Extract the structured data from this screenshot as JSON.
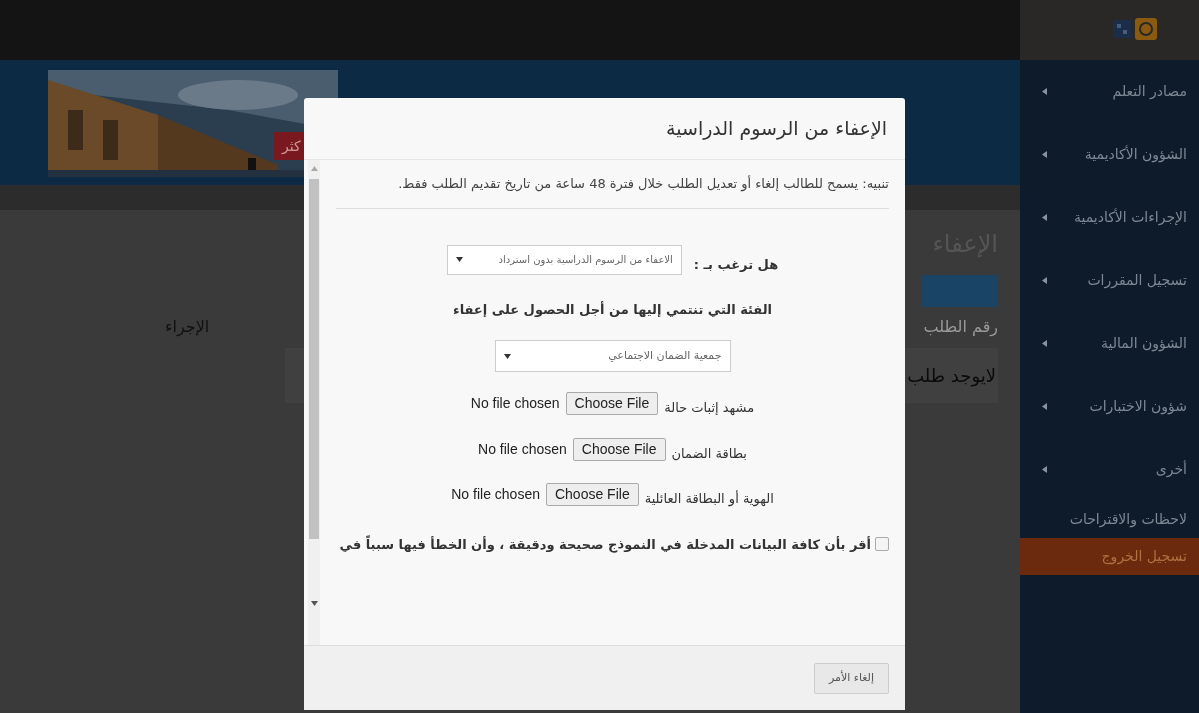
{
  "banner": {
    "badge": "كثر"
  },
  "page": {
    "heading": "الإعفاء",
    "request_number_label": "رقم الطلب",
    "action_label": "الإجراء",
    "empty_message": "لايوجد طلب"
  },
  "sidebar": {
    "items": [
      {
        "label": "مصادر التعلم",
        "kind": "submenu",
        "selected": false
      },
      {
        "label": "الشؤون الأكاديمية",
        "kind": "submenu",
        "selected": false
      },
      {
        "label": "الإجراءات الأكاديمية",
        "kind": "submenu",
        "selected": false
      },
      {
        "label": "تسجيل المقررات",
        "kind": "submenu",
        "selected": false
      },
      {
        "label": "الشؤون المالية",
        "kind": "submenu",
        "selected": false
      },
      {
        "label": "شؤون الاختبارات",
        "kind": "submenu",
        "selected": false
      },
      {
        "label": "أخرى",
        "kind": "submenu",
        "selected": false
      },
      {
        "label": "لاحظات والاقتراحات",
        "kind": "link",
        "selected": false
      },
      {
        "label": "تسجيل الخروج",
        "kind": "link",
        "selected": true
      }
    ]
  },
  "dialog": {
    "title": "الإعفاء من الرسوم الدراسية",
    "notice": "تنبيه: يسمح للطالب إلغاء أو تعديل الطلب خلال فترة 48 ساعة من تاريخ تقديم الطلب فقط.",
    "request_type": {
      "label": "هل ترغب بـ :",
      "value": "الاعفاء من الرسوم الدراسية بدون استرداد"
    },
    "category": {
      "label": "الفئة التي تنتمي إليها من أجل الحصول على إعفاء",
      "value": "جمعية الضمان الاجتماعي"
    },
    "files": [
      {
        "label": "مشهد إثبات حالة",
        "button": "Choose File",
        "status": "No file chosen"
      },
      {
        "label": "بطاقة الضمان",
        "button": "Choose File",
        "status": "No file chosen"
      },
      {
        "label": "الهوية أو البطاقة العائلية",
        "button": "Choose File",
        "status": "No file chosen"
      }
    ],
    "declaration": {
      "text": "أقر بأن كافة البيانات المدخلة في النموذج صحيحة ودقيقة ، وأن الخطأ فيها سبباً في",
      "checked": false
    },
    "cancel_button": "إلغاء الأمر"
  }
}
